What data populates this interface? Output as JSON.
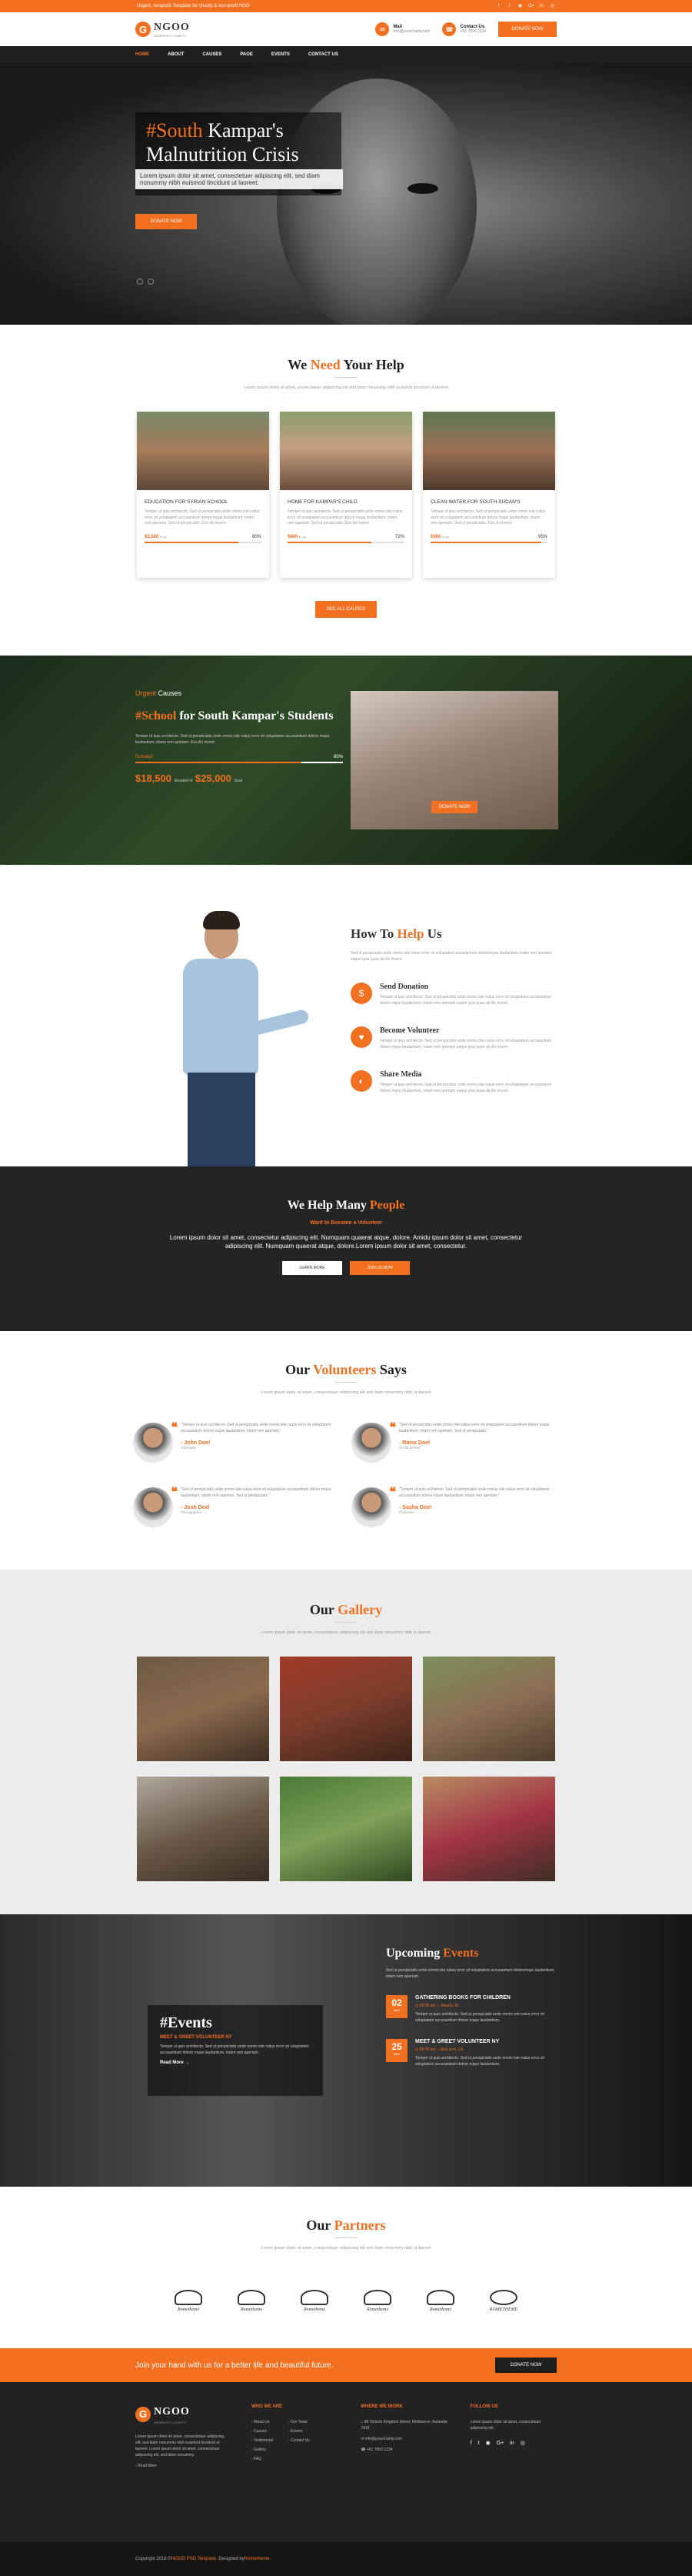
{
  "topbar": {
    "text": "Urgent, nonprofit Template for charity & non-profit NGO",
    "social": [
      "f",
      "t",
      "◉",
      "G+",
      "in",
      "◎"
    ]
  },
  "header": {
    "logo_letter": "G",
    "logo_text": "NGOO",
    "logo_sub": "NONPROFIT CHARITY",
    "mail_label": "Mail",
    "mail_value": "info@yourcharity.com",
    "phone_label": "Contact Us",
    "phone_value": "+61 7000 1234",
    "donate": "DONATE NOW"
  },
  "nav": [
    "HOME",
    "ABOUT",
    "CAUSES",
    "PAGE",
    "EVENTS",
    "CONTACT US"
  ],
  "hero": {
    "title_hl": "#South",
    "title_rest": " Kampar's Malnutrition Crisis",
    "sub": "Lorem ipsum dolor sit amet, consectetuer adipiscing elit, sed diam nonummy nibh euismod tincidunt ut laoreet.",
    "button": "DONATE NOW"
  },
  "help": {
    "title_a": "We ",
    "title_hl": "Need",
    "title_b": " Your Help",
    "sub": "Lorem ipsum dolor sit amet, consectetuer adipiscing elit sed diam nonummy nibh euismod tincidunt ut laoreet",
    "cards": [
      {
        "title": "EDUCATION FOR SYRIAN SCHOOL",
        "text": "Temper ut quis architecto. Sed ut perspiciatis unde omnis iste natus error sit voluptatem accusantium dolore mque laudantium, totam rem aperiam. Sed ut perspiciatis. Eos illo invent.",
        "amount": "$2,580",
        "to": "to go",
        "pct": "80%",
        "fill": 80
      },
      {
        "title": "HOME FOR KAMPAR'S CHILD",
        "text": "Temper ut quis architecto. Sed ut perspiciatis unde omnis iste natus error sit voluptatem accusantium dolore mque laudantium, totam rem aperiam. Sed ut perspiciatis. Eos illo invent.",
        "amount": "$880",
        "to": "to go",
        "pct": "72%",
        "fill": 72
      },
      {
        "title": "CLEAN WATER FOR SOUTH SUDAN'S",
        "text": "Temper ut quis architecto. Sed ut perspiciatis unde omnis iste natus error sit voluptatem accusantium dolore mque laudantium, totam rem aperiam. Sed ut perspiciatis. Eos illo invent.",
        "amount": "$580",
        "to": "to go",
        "pct": "95%",
        "fill": 95
      }
    ],
    "all_button": "SEE ALL CAUSES"
  },
  "urgent": {
    "tag_hl": "Urgent",
    "tag_rest": " Causes",
    "title_hl": "#School",
    "title_rest": " for South Kampar's Students",
    "text": "Temper ut quis architecto. Sed ut perspiciatis unde omnis iste natus error sit voluptatem accusantium dolore mque laudantium, totam rem aperiam. Eos illo invent.",
    "lbl": "Donated",
    "pct": "80%",
    "fill": 80,
    "raised": "$18,500",
    "raised_lbl": "donated of",
    "goal": "$25,000",
    "goal_lbl": "Goal",
    "button": "DONATE NOW"
  },
  "howto": {
    "title_a": "How To ",
    "title_hl": "Help",
    "title_b": " Us",
    "intro": "Sed ut perspiciatis unde omnis iste natus error sit voluptatem accusantium doloremque laudantium totam rem aperiam, eaque ipsa quae ab illo invent.",
    "steps": [
      {
        "icon": "$",
        "title": "Send Donation",
        "text": "Temper ut quis architecto. Sed ut perspiciatis unde omnis iste natus error sit voluptatem accusantium dolore mque laudantium, totam rem aperiam eaque ipsa quae ab illo invent."
      },
      {
        "icon": "♥",
        "title": "Become Volunteer",
        "text": "Temper ut quis architecto. Sed ut perspiciatis unde omnis iste natus error sit voluptatem accusantium dolore mque laudantium, totam rem aperiam eaque ipsa quae ab illo invent."
      },
      {
        "icon": "◐",
        "title": "Share Media",
        "text": "Temper ut quis architecto. Sed ut perspiciatis unde omnis iste natus error sit voluptatem accusantium dolore mque laudantium, totam rem aperiam eaque ipsa quae ab illo invent."
      }
    ]
  },
  "many": {
    "title_a": "We Help Many ",
    "title_hl": "People",
    "sub": "Want to Become a Volunteer",
    "text": "Lorem ipsum dolor sit amet, consectetur adipiscing elit. Numquam quaerat atque, dolore. Amidu ipsum dolor sit amet, consectetur adipiscing elit. Numquam quaerat atque, dolore.Lorem ipsum dolor sit amet, consectetur.",
    "btn1": "LEARN MORE",
    "btn2": "JOIN US NOW"
  },
  "volunteers": {
    "title_a": "Our ",
    "title_hl": "Volunteers",
    "title_b": " Says",
    "sub": "Lorem ipsum dolor sit amet, consectetuer adipiscing elit sed diam nonummy nibh ut laoreet",
    "items": [
      {
        "text": "\"Temper ut quis architecto. Sed ut perspiciatis unde omnis iste natus error sit voluptatem accusantium dolore mque laudantium, totam rem aperiam.\"",
        "name": "- John Doel",
        "role": "Journalist"
      },
      {
        "text": "\"Sed ut perspiciatis unde omnis iste natus error sit voluptatem accusantium dolore mque laudantium, totam rem aperiam, Sed ut perspiciatis.\"",
        "name": "- Raisa Doel",
        "role": "Social Worker"
      },
      {
        "text": "\"Sed ut perspiciatis unde omnis iste natus error sit voluptatem accusantium dolore mque laudantium, totam rem aperiam. Sed ut perspiciatis.\"",
        "name": "- Josh Doel",
        "role": "Photographer"
      },
      {
        "text": "\"Temper ut quis architecto. Sed ut perspiciatis unde omnis iste natus error sit voluptatem accusantium dolore mque laudantium, totam rem aperiam.\"",
        "name": "- Sasha Doel",
        "role": "Professor"
      }
    ]
  },
  "gallery": {
    "title_a": "Our ",
    "title_hl": "Gallery",
    "sub": "Lorem ipsum dolor sit amet, consectetuer adipiscing elit sed diam nonummy nibh ut laoreet",
    "images": [
      {
        "a": "#6b5a44",
        "b": "#8c6a4e",
        "c": "#3d2e22"
      },
      {
        "a": "#a33a2a",
        "b": "#7c3d2b",
        "c": "#3b2419"
      },
      {
        "a": "#7c8f5e",
        "b": "#8c6e53",
        "c": "#4d3d2d"
      },
      {
        "a": "#b0a79c",
        "b": "#6b5a48",
        "c": "#3a2b20"
      },
      {
        "a": "#4a7a34",
        "b": "#7fa158",
        "c": "#2f4a21"
      },
      {
        "a": "#b88d62",
        "b": "#a23445",
        "c": "#3e2e22"
      }
    ]
  },
  "events": {
    "box_title": "#Events",
    "box_sub": "MEET & GREET VOLUNTEER NY",
    "box_text": "Temper ut quis architecto. Sed ut perspiciatis unde omnis iste natus error sit voluptatem accusantium dolore mque laudantium, totam rem aperiam.",
    "read_more": "Read More →",
    "title_a": "Upcoming ",
    "title_hl": "Events",
    "intro": "Sed ut perspiciatis unde omnis iste natus error sit voluptatem accusantium doloremque laudantium, totam rem aperiam.",
    "items": [
      {
        "day": "02",
        "month": "MAY",
        "title": "GATHERING BOOKS FOR CHILDREN",
        "meta": "◷ 09:00 am   ⌂ Jakarta, ID",
        "text": "Temper ut quis architecto. Sed ut perspiciatis unde omnis iste natus error sit voluptatem accusantium dolore mque laudantium."
      },
      {
        "day": "25",
        "month": "MAY",
        "title": "MEET & GREET VOLUNTEER NY",
        "meta": "◷ 08:00 am   ⌂ New york, US",
        "text": "Temper ut quis architecto. Sed ut perspiciatis unde omnis iste natus error sit voluptatem accusantium dolore mque laudantium."
      }
    ]
  },
  "partners": {
    "title_a": "Our ",
    "title_hl": "Partners",
    "sub": "Lorem ipsum dolor sit amet, consectetuer adipiscing elit sed diam nonummy nibh ut laoreet",
    "logos": [
      "Rometheme",
      "Rometheme",
      "Rometheme",
      "Rometheme",
      "Rometheme",
      "ROMETHEME"
    ]
  },
  "join": {
    "text": "Join your hand with us for a better life and beautiful future.",
    "button": "DONATE NOW"
  },
  "footer": {
    "about": "Lorem ipsum dolor sit amet, consectetuer adipiscing elit, sed diam nonummy nibh euismod tincidunt ut laoreet. Lorem ipsum dolor sit amet, consectetuer adipiscing elit, sed diam nonummy.",
    "read_more": "Read More",
    "col1_title": "WHO WE ARE",
    "col1": [
      "About Us",
      "Causes",
      "Testimonial",
      "Gallery",
      "FAQ"
    ],
    "col1b": [
      "Our Team",
      "Events",
      "Contact Us"
    ],
    "col2_title": "WHERE WE WORK",
    "col2": [
      "⌂ 89 Victoria Kingdom Street, Melbourne, Australia 7410",
      "✉ info@yourcharity.com",
      "☎ +61 7000 1234"
    ],
    "col3_title": "FOLLOW US",
    "col3_text": "Lorem ipsum dolor sit amet, consectetuer adipiscing elit.",
    "social": [
      "f",
      "t",
      "◉",
      "G+",
      "in",
      "◎"
    ],
    "copyright_a": "Copyright 2018 © ",
    "copyright_hl": "NGOO PSD Template",
    "copyright_b": ". Designed by ",
    "copyright_hl2": "Rometheme."
  }
}
